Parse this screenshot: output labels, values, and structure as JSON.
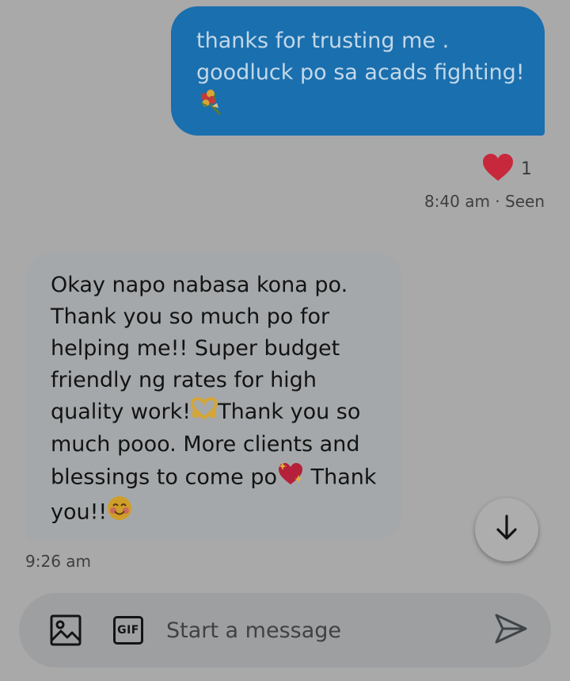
{
  "colors": {
    "background": "#a9a9a9",
    "outgoing_bubble": "#1a6fae",
    "outgoing_text": "#c3d8e9",
    "incoming_bubble": "#a5a8aa",
    "incoming_text": "#131313",
    "heart": "#c8283c",
    "composer": "#9d9fa1"
  },
  "outgoing_message": {
    "lines": [
      "thanks for trusting me .",
      "goodluck po sa acads fighting!"
    ],
    "emoji": "bouquet-icon"
  },
  "reaction": {
    "icon": "heart-icon",
    "count": "1"
  },
  "outgoing_meta": "8:40 am · Seen",
  "incoming_message": {
    "lines": [
      "Okay napo nabasa kona po.",
      "Thank you so much po for",
      "helping me!! Super budget",
      "friendly ng rates for high",
      "quality work!",
      "Thank you so",
      "much pooo. More clients and",
      "blessings to come po",
      " Thank",
      "you!!"
    ],
    "emojis": [
      "heart-hands-icon",
      "sparkling-heart-icon",
      "smiling-face-icon"
    ]
  },
  "incoming_meta": "9:26 am",
  "scroll_button": {
    "icon": "arrow-down-icon"
  },
  "composer": {
    "placeholder": "Start a message",
    "image_icon": "image-icon",
    "gif_label": "GIF",
    "send_icon": "send-icon"
  }
}
